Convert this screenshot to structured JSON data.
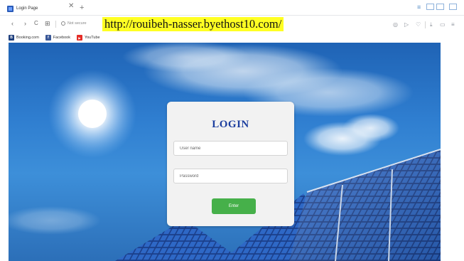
{
  "browser": {
    "tab": {
      "title": "Login Page",
      "close": "✕",
      "new_tab": "+"
    },
    "nav": {
      "back": "‹",
      "forward": "›",
      "reload": "C",
      "apps": "⊞",
      "security": "Not secure"
    },
    "url_annotation": "http://rouibeh-nasser.byethost10.com/",
    "right_icons": {
      "camera": "◎",
      "send": "▷",
      "heart": "♡",
      "download": "⤓",
      "battery": "▭",
      "menu": "≡"
    },
    "window": {
      "minimize_glyph": "–",
      "menu_glyph": "≡"
    }
  },
  "bookmarks": [
    {
      "label": "Booking.com",
      "icon": "booking-icon",
      "color": "#1f3f7d",
      "glyph": "B"
    },
    {
      "label": "Facebook",
      "icon": "facebook-icon",
      "color": "#3b5998",
      "glyph": "f"
    },
    {
      "label": "YouTube",
      "icon": "youtube-icon",
      "color": "#e52d27",
      "glyph": "▶"
    }
  ],
  "login": {
    "title": "LOGIN",
    "username_placeholder": "User name",
    "password_placeholder": "Password",
    "submit_label": "Enter"
  },
  "colors": {
    "title_blue": "#1d3f9f",
    "button_green": "#46b04a",
    "highlight_yellow": "#ffff23",
    "sky_blue": "#2f7ed0"
  }
}
